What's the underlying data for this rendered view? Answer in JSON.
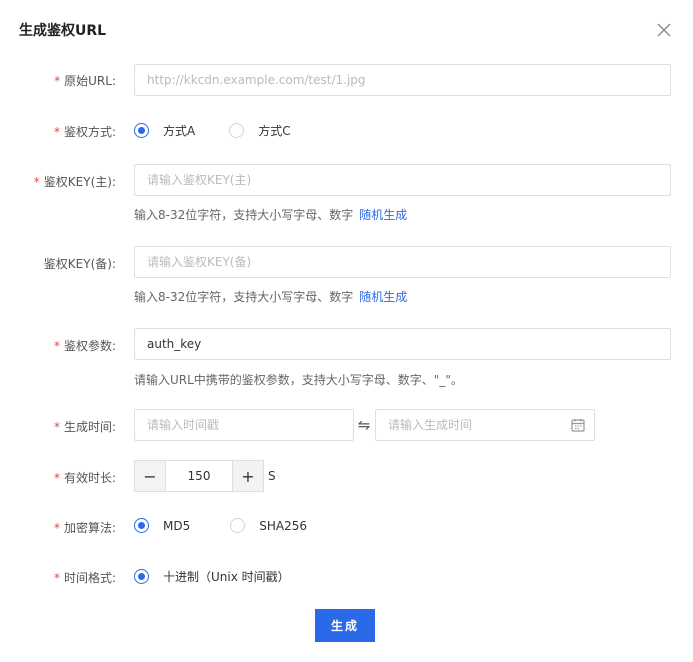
{
  "dialog": {
    "title": "生成鉴权URL"
  },
  "form": {
    "required_mark": "*",
    "original_url": {
      "label": "原始URL:",
      "placeholder": "http://kkcdn.example.com/test/1.jpg"
    },
    "auth_method": {
      "label": "鉴权方式:",
      "options": [
        "方式A",
        "方式C"
      ],
      "selected": "方式A"
    },
    "auth_key_primary": {
      "label": "鉴权KEY(主):",
      "placeholder": "请输入鉴权KEY(主)",
      "hint": "输入8-32位字符，支持大小写字母、数字",
      "link": "随机生成"
    },
    "auth_key_backup": {
      "label": "鉴权KEY(备):",
      "placeholder": "请输入鉴权KEY(备)",
      "hint": "输入8-32位字符，支持大小写字母、数字",
      "link": "随机生成"
    },
    "auth_param": {
      "label": "鉴权参数:",
      "value": "auth_key",
      "hint": "请输入URL中携带的鉴权参数，支持大小写字母、数字、\"_\"。"
    },
    "generate_time": {
      "label": "生成时间:",
      "timestamp_placeholder": "请输入时间戳",
      "time_placeholder": "请输入生成时间",
      "swap_glyph": "⇋"
    },
    "valid_duration": {
      "label": "有效时长:",
      "minus": "−",
      "value": "150",
      "plus": "+",
      "unit": "S"
    },
    "encryption": {
      "label": "加密算法:",
      "options": [
        "MD5",
        "SHA256"
      ],
      "selected": "MD5"
    },
    "time_format": {
      "label": "时间格式:",
      "options": [
        "十进制（Unix 时间戳）"
      ],
      "selected": "十进制（Unix 时间戳）"
    },
    "submit_label": "生成"
  },
  "colors": {
    "primary": "#2a6ae9",
    "required": "#e54545",
    "border": "#dcdfe6"
  }
}
